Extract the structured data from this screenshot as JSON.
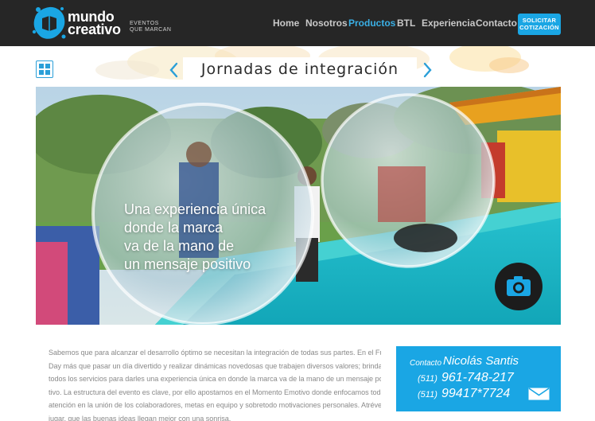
{
  "brand": {
    "name_line1": "mundo",
    "name_line2": "creativo",
    "tagline_line1": "EVENTOS",
    "tagline_line2": "QUE MARCAN"
  },
  "nav": {
    "items": [
      {
        "label": "Home"
      },
      {
        "label": "Nosotros"
      },
      {
        "label": "Productos",
        "active": true
      },
      {
        "label": "BTL"
      },
      {
        "label": "Experiencia"
      },
      {
        "label": "Contacto"
      }
    ],
    "cta_line1": "SOLICITAR",
    "cta_line2": "COTIZACIÓN"
  },
  "page": {
    "title": "Jornadas de integración"
  },
  "hero": {
    "caption_lines": [
      "Una experiencia única",
      "donde la marca",
      "va de la mano de",
      "un mensaje positivo"
    ]
  },
  "description_lines": [
    "Sabemos que para alcanzar el desarrollo óptimo se necesitan la integración de todas sus partes. En el Full",
    "Day más que pasar un día divertido y realizar dinámicas novedosas que trabajen diversos valores; brindamos",
    "todos los servicios para darles una experiencia única en donde la marca va de la mano de un mensaje posi-",
    "tivo. La estructura del evento es clave, por ello apostamos en el Momento Emotivo donde enfocamos toda la",
    "atención en la unión de los colaboradores, metas en equipo y sobretodo motivaciones personales. Atrévete a",
    "jugar, que las buenas ideas llegan mejor con una sonrisa."
  ],
  "contact": {
    "label": "Contacto",
    "name": "Nicolás Santis",
    "phones": [
      {
        "prefix": "(511)",
        "number": "961-748-217"
      },
      {
        "prefix": "(511)",
        "number": "99417*7724"
      }
    ]
  },
  "colors": {
    "header_bg": "#262626",
    "accent": "#1aa6e4",
    "nav_active": "#3ab0e6",
    "nav_text": "#c9c9c9",
    "body_text": "#8a8a8a"
  },
  "icons": [
    "brand-logo-icon",
    "grid-icon",
    "chevron-left-icon",
    "chevron-right-icon",
    "camera-icon",
    "mail-icon"
  ]
}
